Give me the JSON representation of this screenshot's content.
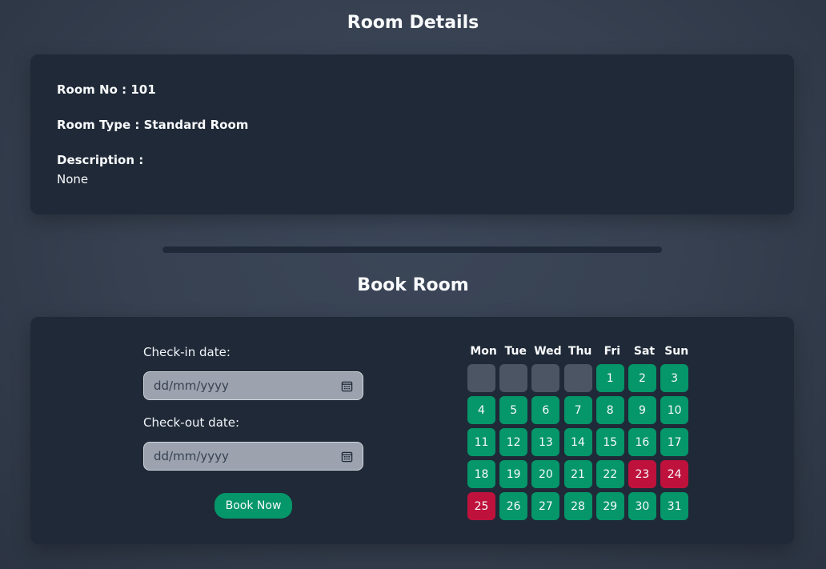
{
  "details": {
    "heading": "Room Details",
    "room_no_label": "Room No : 101",
    "room_type_label": "Room Type : Standard Room",
    "description_label": "Description :",
    "description_value": "None"
  },
  "booking": {
    "heading": "Book Room",
    "checkin_label": "Check-in date:",
    "checkin_placeholder": "dd/mm/yyyy",
    "checkout_label": "Check-out date:",
    "checkout_placeholder": "dd/mm/yyyy",
    "book_button": "Book Now",
    "icon": "calendar-icon"
  },
  "calendar": {
    "weekdays": [
      "Mon",
      "Tue",
      "Wed",
      "Thu",
      "Fri",
      "Sat",
      "Sun"
    ],
    "leading_blank_days": 4,
    "days": [
      {
        "day": "1",
        "status": "available"
      },
      {
        "day": "2",
        "status": "available"
      },
      {
        "day": "3",
        "status": "available"
      },
      {
        "day": "4",
        "status": "available"
      },
      {
        "day": "5",
        "status": "available"
      },
      {
        "day": "6",
        "status": "available"
      },
      {
        "day": "7",
        "status": "available"
      },
      {
        "day": "8",
        "status": "available"
      },
      {
        "day": "9",
        "status": "available"
      },
      {
        "day": "10",
        "status": "available"
      },
      {
        "day": "11",
        "status": "available"
      },
      {
        "day": "12",
        "status": "available"
      },
      {
        "day": "13",
        "status": "available"
      },
      {
        "day": "14",
        "status": "available"
      },
      {
        "day": "15",
        "status": "available"
      },
      {
        "day": "16",
        "status": "available"
      },
      {
        "day": "17",
        "status": "available"
      },
      {
        "day": "18",
        "status": "available"
      },
      {
        "day": "19",
        "status": "available"
      },
      {
        "day": "20",
        "status": "available"
      },
      {
        "day": "21",
        "status": "available"
      },
      {
        "day": "22",
        "status": "available"
      },
      {
        "day": "23",
        "status": "booked"
      },
      {
        "day": "24",
        "status": "booked"
      },
      {
        "day": "25",
        "status": "booked"
      },
      {
        "day": "26",
        "status": "available"
      },
      {
        "day": "27",
        "status": "available"
      },
      {
        "day": "28",
        "status": "available"
      },
      {
        "day": "29",
        "status": "available"
      },
      {
        "day": "30",
        "status": "available"
      },
      {
        "day": "31",
        "status": "available"
      }
    ],
    "colors": {
      "available": "#059669",
      "booked": "#be123c",
      "empty": "#4b5563"
    }
  }
}
